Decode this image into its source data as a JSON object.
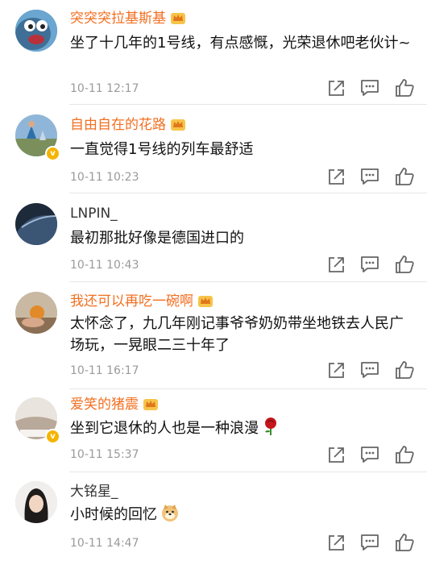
{
  "colors": {
    "vip_name": "#f26f21",
    "normal_name": "#333333",
    "time": "#9a9a9a",
    "icon": "#666666"
  },
  "icons": [
    "share-icon",
    "reply-icon",
    "like-icon"
  ],
  "comments": [
    {
      "name": "突突突拉基斯基",
      "vip": true,
      "text": "坐了十几年的1号线，有点感慨，光荣退休吧老伙计~",
      "time": "10-11 12:17"
    },
    {
      "name": "自由自在的花路",
      "vip": true,
      "text": "一直觉得1号线的列车最舒适",
      "time": "10-11 10:23"
    },
    {
      "name": "LNPIN_",
      "vip": false,
      "text": "最初那批好像是德国进口的",
      "time": "10-11 10:43"
    },
    {
      "name": "我还可以再吃一碗啊",
      "vip": true,
      "text": "太怀念了，九几年刚记事爷爷奶奶带坐地铁去人民广场玩，一晃眼二三十年了",
      "time": "10-11 16:17"
    },
    {
      "name": "爱笑的猪震",
      "vip": true,
      "text": "坐到它退休的人也是一种浪漫",
      "time": "10-11 15:37",
      "emoji": "rose-emoji"
    },
    {
      "name": "大铭星_",
      "vip": false,
      "text": "小时候的回忆",
      "time": "10-11 14:47",
      "emoji": "doge-emoji"
    }
  ]
}
